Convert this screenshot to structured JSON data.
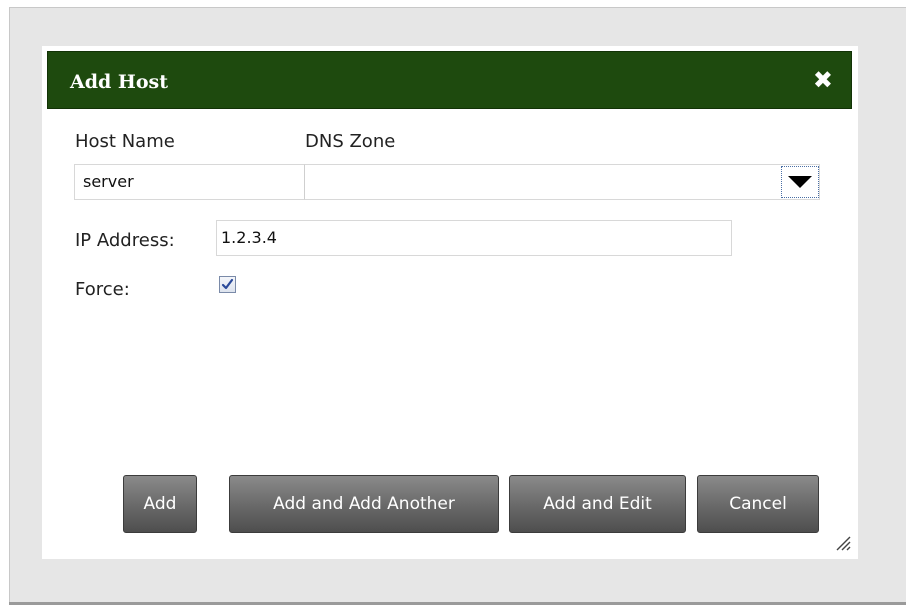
{
  "dialog": {
    "title": "Add Host",
    "close_icon": "close-icon"
  },
  "form": {
    "host_name_label": "Host Name",
    "dns_zone_label": "DNS Zone",
    "host_name_value": "server",
    "dns_zone_value": "",
    "ip_address_label": "IP Address:",
    "ip_address_value": "1.2.3.4",
    "force_label": "Force:",
    "force_checked": true
  },
  "buttons": {
    "add": "Add",
    "add_and_add_another": "Add and Add Another",
    "add_and_edit": "Add and Edit",
    "cancel": "Cancel"
  },
  "colors": {
    "titlebar": "#1e4a0e",
    "button_gradient_top": "#8a8a8a",
    "button_gradient_bottom": "#4e4e4e",
    "page_background": "#e6e6e6"
  }
}
